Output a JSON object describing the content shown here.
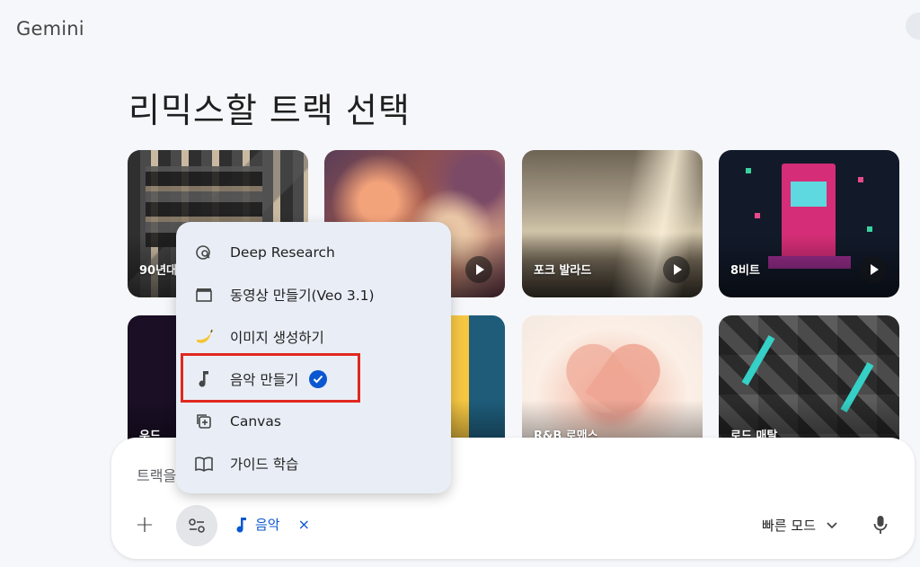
{
  "app": {
    "brand": "Gemini"
  },
  "page": {
    "title": "리믹스할 트랙 선택"
  },
  "tracks": [
    {
      "label": "90년대",
      "art": "abstract-collage"
    },
    {
      "label": "",
      "art": "pink-floral"
    },
    {
      "label": "포크 발라드",
      "art": "sepia-landscape"
    },
    {
      "label": "8비트",
      "art": "pixel-arcade"
    },
    {
      "label": "우드",
      "art": "neon-figure"
    },
    {
      "label": "",
      "art": "tropical-color"
    },
    {
      "label": "R&B 로맨스",
      "art": "heart-hands"
    },
    {
      "label": "로드 매탈",
      "art": "dark-geometric"
    }
  ],
  "composer": {
    "placeholder": "트랙을",
    "active_tool": {
      "icon": "music-note-icon",
      "label": "음악",
      "remove": "×"
    },
    "mode": "빠른 모드"
  },
  "menu": {
    "items": [
      {
        "icon": "deep-research-icon",
        "label": "Deep Research",
        "selected": false
      },
      {
        "icon": "video-clapper-icon",
        "label": "동영상 만들기(Veo 3.1)",
        "selected": false
      },
      {
        "icon": "banana-icon",
        "label": "이미지 생성하기",
        "selected": false
      },
      {
        "icon": "music-note-icon",
        "label": "음악 만들기",
        "selected": true
      },
      {
        "icon": "canvas-icon",
        "label": "Canvas",
        "selected": false
      },
      {
        "icon": "book-icon",
        "label": "가이드 학습",
        "selected": false
      }
    ]
  },
  "colors": {
    "accent": "#0b57d0",
    "highlight": "#e0281f",
    "background": "#f6f7fa",
    "menu": "#e9eef6"
  }
}
